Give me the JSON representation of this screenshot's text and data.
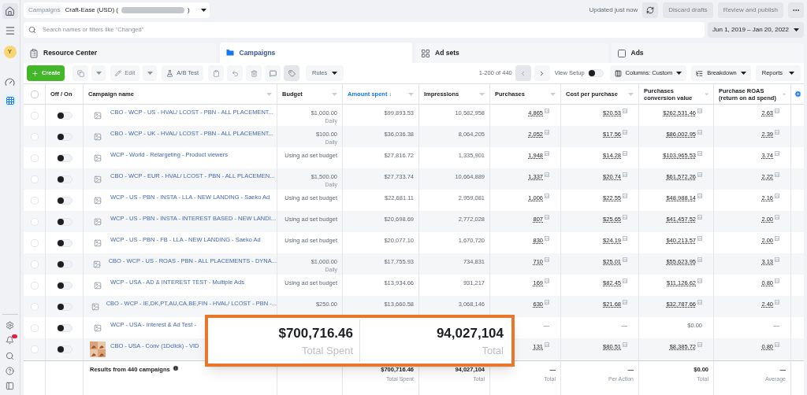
{
  "top_bar": {
    "breadcrumb": "Campaigns",
    "account_prefix": "Craft-Ease (USD) (",
    "account_suffix": ")",
    "status": "Updated just now",
    "buttons": [
      {
        "label": "Discard drafts",
        "disabled": true
      },
      {
        "label": "Review and publish",
        "disabled": true
      }
    ]
  },
  "avatar": "Y",
  "search": {
    "placeholder": "Search names or filters like \"Changed\""
  },
  "date_range": "Jun 1, 2019 – Jan 20, 2022",
  "tabs": [
    {
      "label": "Resource Center",
      "kind": "resource",
      "selected": false
    },
    {
      "label": "Campaigns",
      "kind": "campaigns",
      "selected": true
    },
    {
      "label": "Ad sets",
      "kind": "adsets",
      "selected": false
    },
    {
      "label": "Ads",
      "kind": "ads",
      "selected": false
    }
  ],
  "toolbar": {
    "create": "Create",
    "edit": "Edit",
    "ab_test": "A/B Test",
    "rules": "Rules",
    "pagination": "1-200 of 440",
    "view_setup": {
      "label": "View Setup",
      "on": false
    },
    "columns": "Columns: Custom",
    "breakdown": "Breakdown",
    "reports": "Reports"
  },
  "select_all": {
    "checked": false
  },
  "columns": [
    {
      "label": "Off / On",
      "sorted": false
    },
    {
      "label": "Campaign name",
      "sorted": false
    },
    {
      "label": "Budget",
      "sorted": false
    },
    {
      "label": "Amount spent ↓",
      "sorted": true
    },
    {
      "label": "Impressions",
      "sorted": false
    },
    {
      "label": "Purchases",
      "sorted": false
    },
    {
      "label": "Cost per purchase",
      "sorted": false
    },
    {
      "label": "Purchases conversion value",
      "sorted": false
    },
    {
      "label": "Purchase ROAS (return on ad spend)",
      "sorted": false
    }
  ],
  "rows": [
    {
      "checked": false,
      "on": false,
      "kind": "icon",
      "name": "CBO - WCP - US - HVAL/ LCOST - PBN - ALL PLACEMENT...",
      "budget": "$1,000.00",
      "budget_note": "Daily",
      "amount": "$99,893.53",
      "impressions": "10,582,958",
      "has_results": true,
      "purchases": "4,865",
      "cost": "$20.53",
      "value": "$262,531.46",
      "roas": "2.63"
    },
    {
      "checked": false,
      "on": false,
      "kind": "icon",
      "name": "CBO - WCP - UK - HVAL/ LCOST - PBN - ALL PLACEMENT...",
      "budget": "$100.00",
      "budget_note": "Daily",
      "amount": "$36,036.38",
      "impressions": "8,064,205",
      "has_results": true,
      "purchases": "2,052",
      "cost": "$17.56",
      "value": "$86,002.95",
      "roas": "2.39"
    },
    {
      "checked": false,
      "on": false,
      "kind": "icon",
      "name": "WCP - World - Retargeting - Product viewers",
      "budget": "Using ad set budget",
      "amount": "$27,816.72",
      "impressions": "1,335,901",
      "has_results": true,
      "purchases": "1,948",
      "cost": "$14.28",
      "value": "$103,965.53",
      "roas": "3.74"
    },
    {
      "checked": false,
      "on": false,
      "kind": "icon",
      "name": "CBO - WCP - EUR - HVAL/ LCOST - PBN - ALL PLACEMEN...",
      "budget": "$1,500.00",
      "budget_note": "Daily",
      "amount": "$27,733.74",
      "impressions": "10,664,889",
      "has_results": true,
      "purchases": "1,337",
      "cost": "$20.74",
      "value": "$61,572.26",
      "roas": "2.22"
    },
    {
      "checked": false,
      "on": false,
      "kind": "icon",
      "name": "WCP - US - PBN - INSTA - LLA - NEW LANDING - Saeko Ad",
      "budget": "Using ad set budget",
      "amount": "$22,681.11",
      "impressions": "2,959,081",
      "has_results": true,
      "purchases": "1,006",
      "cost": "$22.55",
      "value": "$48,988.14",
      "roas": "2.16"
    },
    {
      "checked": false,
      "on": false,
      "kind": "icon",
      "name": "WCP - US - PBN - INSTA - INTEREST BASED - NEW LANDI...",
      "budget": "Using ad set budget",
      "amount": "$20,698.69",
      "impressions": "2,772,028",
      "has_results": true,
      "purchases": "807",
      "cost": "$25.65",
      "value": "$41,457.52",
      "roas": "2.00"
    },
    {
      "checked": false,
      "on": false,
      "kind": "icon",
      "name": "WCP - US - PBN - FB - LLA - NEW LANDING - Saeko Ad",
      "budget": "Using ad set budget",
      "amount": "$20,077.10",
      "impressions": "1,670,720",
      "has_results": true,
      "purchases": "830",
      "cost": "$24.19",
      "value": "$40,213.57",
      "roas": "2.00"
    },
    {
      "checked": false,
      "on": false,
      "kind": "icon",
      "name": "CBO - WCP - US - ROAS - PBN - ALL PLACEMENTS - DYNA...",
      "budget": "$1,000.00",
      "budget_note": "Daily",
      "amount": "$17,755.93",
      "impressions": "734,831",
      "has_results": true,
      "purchases": "710",
      "cost": "$25.01",
      "value": "$55,623.95",
      "roas": "3.13"
    },
    {
      "checked": false,
      "on": false,
      "kind": "icon",
      "name": "WCP - USA - AD & INTEREST TEST - Multiple Ads",
      "budget": "Using ad set budget",
      "amount": "$13,934.66",
      "impressions": "931,217",
      "has_results": true,
      "purchases": "169",
      "cost": "$82.45",
      "value": "$11,126.62",
      "roas": "0.80"
    },
    {
      "checked": false,
      "on": false,
      "kind": "icon",
      "name": "CBO - WCP - IE,DK,PT,AU,CA,BE,FIN - HVAL/ LCOST - PBN -...",
      "budget": "$250.00",
      "amount": "$13,660.58",
      "impressions": "3,068,146",
      "has_results": true,
      "purchases": "630",
      "cost": "$21.68",
      "value": "$32,787.66",
      "roas": "2.40"
    },
    {
      "checked": false,
      "on": false,
      "kind": "icon",
      "name": "WCP - USA - Interest & Ad Test -",
      "has_results": false,
      "purchases": "—",
      "cost": "—",
      "value": "$0.00",
      "roas": "—"
    },
    {
      "checked": false,
      "on": false,
      "kind": "picture",
      "name": "CBO - USA - Conv (1Dclick) - VID",
      "has_results": true,
      "purchases": "131",
      "cost": "$80.51",
      "value": "$8,385.72",
      "roas": "0.80"
    }
  ],
  "footer": {
    "label": "Results from 440 campaigns",
    "cells": [
      {
        "value": "$700,716.46",
        "note": "Total Spent"
      },
      {
        "value": "94,027,104",
        "note": "Total"
      },
      {
        "value": "—",
        "note": "Total"
      },
      {
        "value": "—",
        "note": "Per Action"
      },
      {
        "value": "$0.00",
        "note": "Total"
      },
      {
        "value": "—",
        "note": "Average"
      }
    ]
  },
  "callout": [
    {
      "value": "$700,716.46",
      "note": "Total Spent"
    },
    {
      "value": "94,027,104",
      "note": "Total"
    }
  ]
}
